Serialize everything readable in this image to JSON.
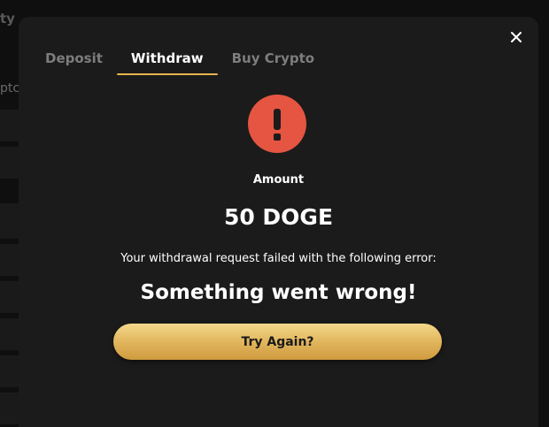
{
  "background": {
    "header_fragment": "ty",
    "sub_fragment": "ptc"
  },
  "modal": {
    "tabs": [
      {
        "label": "Deposit",
        "active": false
      },
      {
        "label": "Withdraw",
        "active": true
      },
      {
        "label": "Buy Crypto",
        "active": false
      }
    ],
    "amount_label": "Amount",
    "amount_value": "50 DOGE",
    "error_description": "Your withdrawal request failed with the following error:",
    "error_title": "Something went wrong!",
    "retry_button_label": "Try Again?"
  },
  "icons": {
    "close": "close-icon",
    "error": "exclamation-icon"
  },
  "colors": {
    "modal_background": "#1b1b1b",
    "accent": "#e6b54b",
    "error_red": "#e55541",
    "inactive_tab": "#7d7d7d"
  }
}
